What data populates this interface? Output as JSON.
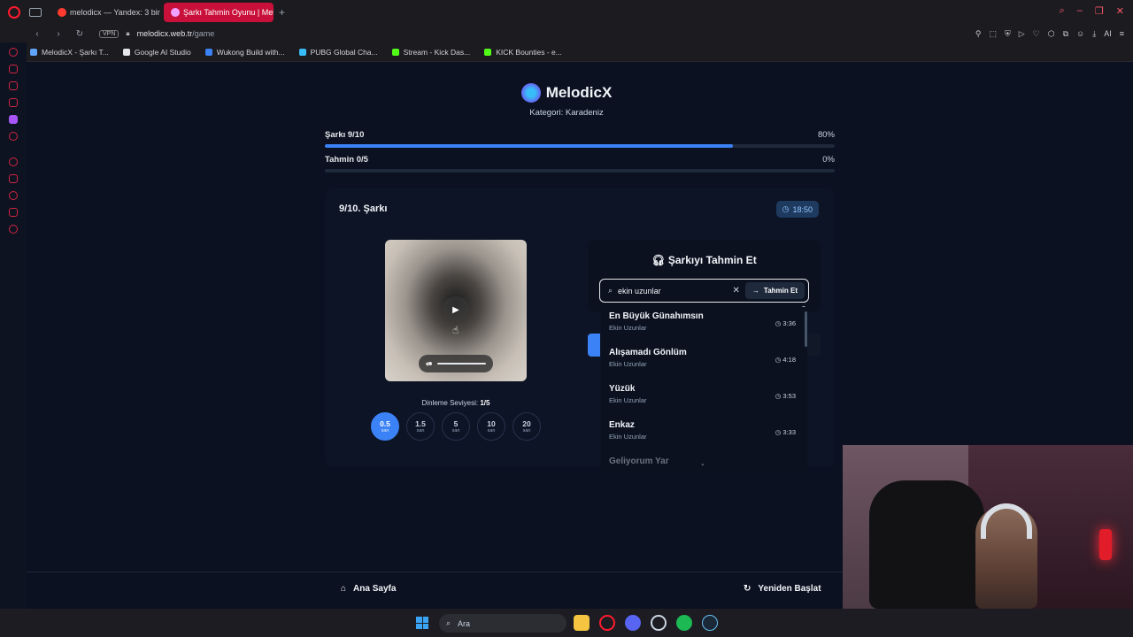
{
  "browser": {
    "tabs": [
      {
        "label": "melodicx — Yandex: 3 bin",
        "active": false,
        "favicon_color": "#ff3b30"
      },
      {
        "label": "Şarkı Tahmin Oyunu | Melo",
        "active": true,
        "favicon_color": "#f0a0ff"
      }
    ],
    "new_tab_label": "+",
    "url_host": "melodicx.web.tr",
    "url_path": "/game",
    "vpn_label": "VPN",
    "ai_label": "AI",
    "bookmarks": [
      {
        "label": "MelodicX - Şarkı T...",
        "color": "#60a5fa"
      },
      {
        "label": "Google AI Studio",
        "color": "#e5e7eb"
      },
      {
        "label": "Wukong Build with...",
        "color": "#3b82f6"
      },
      {
        "label": "PUBG Global Cha...",
        "color": "#38bdf8"
      },
      {
        "label": "Stream - Kick Das...",
        "color": "#53fc18"
      },
      {
        "label": "KICK Bounties - e...",
        "color": "#53fc18"
      }
    ]
  },
  "app": {
    "brand": "MelodicX",
    "category": "Kategori: Karadeniz",
    "song_progress": {
      "label": "Şarkı 9/10",
      "percent_label": "80%",
      "fraction": 0.8
    },
    "guess_progress": {
      "label": "Tahmin 0/5",
      "percent_label": "0%",
      "fraction": 0.0
    },
    "song_title": "9/10. Şarkı",
    "timer": "18:50",
    "listen_level_label": "Dinleme Seviyesi:",
    "listen_level_value": "1/5",
    "levels": [
      {
        "value": "0.5",
        "unit": "san",
        "active": true
      },
      {
        "value": "1.5",
        "unit": "san",
        "active": false
      },
      {
        "value": "5",
        "unit": "san",
        "active": false
      },
      {
        "value": "10",
        "unit": "san",
        "active": false
      },
      {
        "value": "20",
        "unit": "san",
        "active": false
      }
    ],
    "guess_title": "Şarkıyı Tahmin Et",
    "search_value": "ekin uzunlar",
    "guess_button": "Tahmin Et",
    "suggestions": [
      {
        "title": "En Büyük Günahımsın",
        "artist": "Ekin Uzunlar",
        "duration": "3:36"
      },
      {
        "title": "Alışamadı Gönlüm",
        "artist": "Ekin Uzunlar",
        "duration": "4:18"
      },
      {
        "title": "Yüzük",
        "artist": "Ekin Uzunlar",
        "duration": "3:53"
      },
      {
        "title": "Enkaz",
        "artist": "Ekin Uzunlar",
        "duration": "3:33"
      },
      {
        "title": "Geliyorum Yar",
        "artist": "",
        "duration": ""
      }
    ],
    "footer_home": "Ana Sayfa",
    "footer_restart": "Yeniden Başlat"
  },
  "taskbar": {
    "search_placeholder": "Ara"
  }
}
